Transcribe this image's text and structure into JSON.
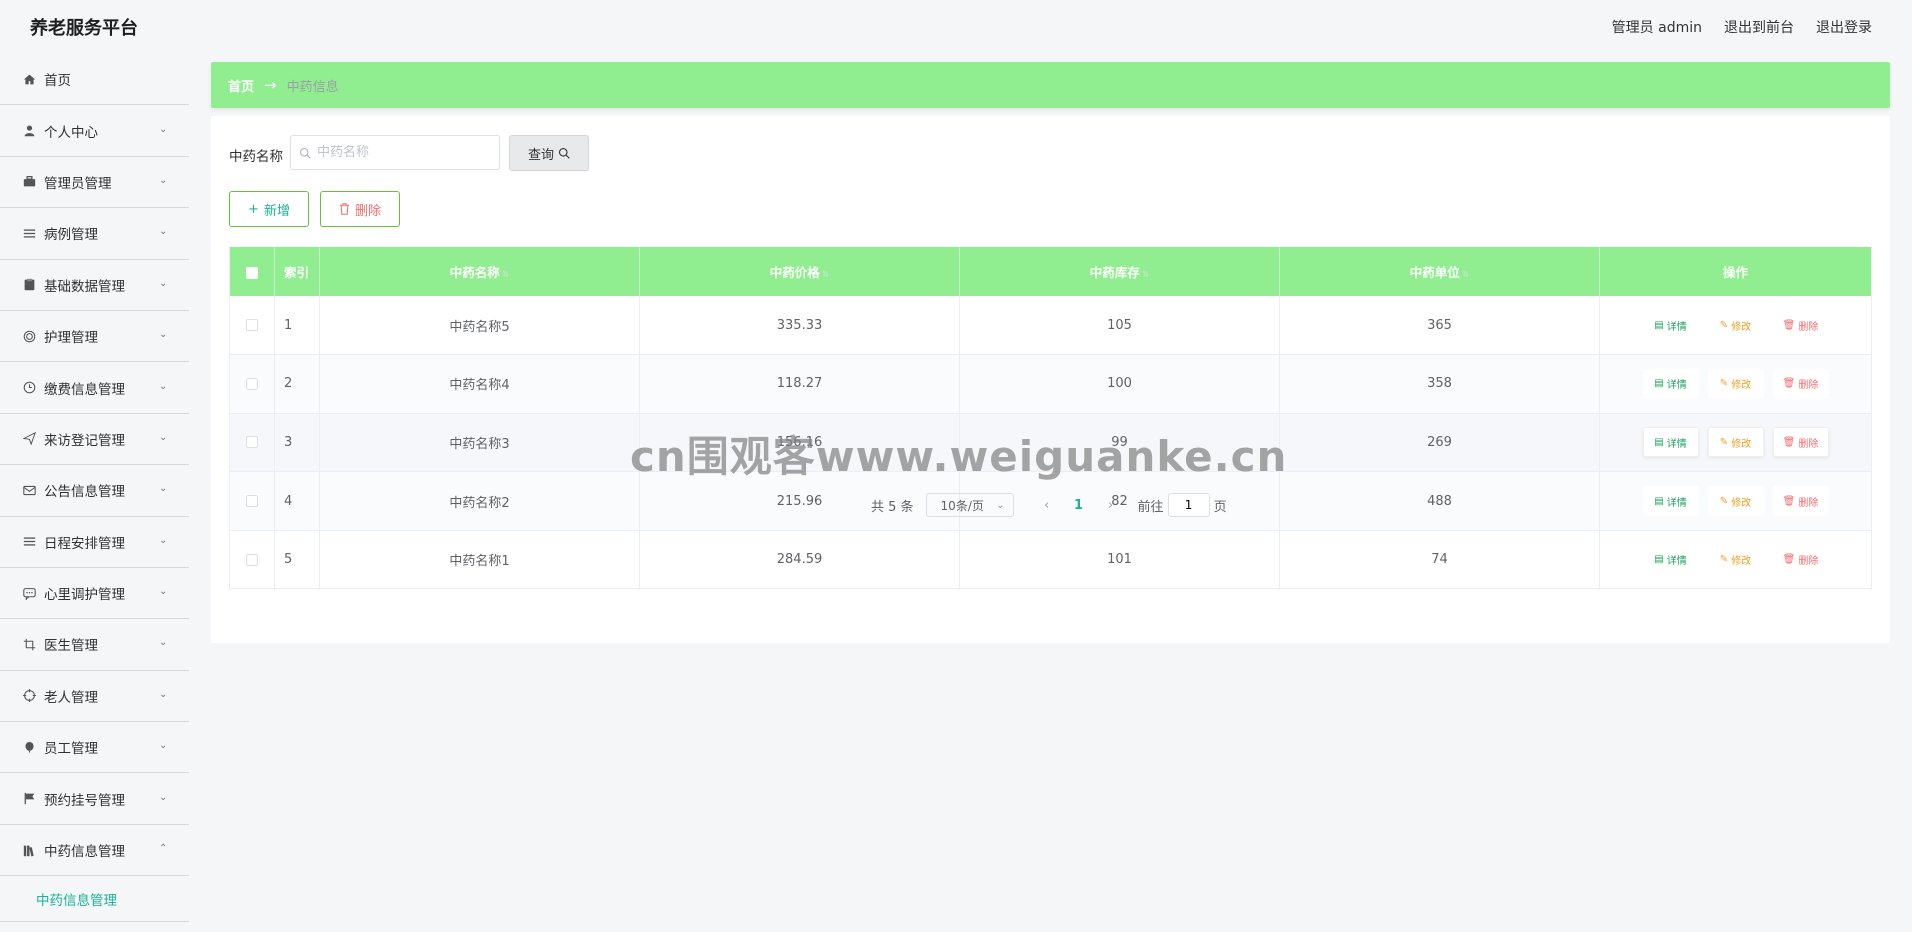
{
  "header": {
    "title": "养老服务平台",
    "admin_label": "管理员 admin",
    "back_front": "退出到前台",
    "logout": "退出登录"
  },
  "sidebar": {
    "items": [
      {
        "label": "首页",
        "icon": "home-icon"
      },
      {
        "label": "个人中心",
        "icon": "user-icon"
      },
      {
        "label": "管理员管理",
        "icon": "briefcase-icon"
      },
      {
        "label": "病例管理",
        "icon": "list-icon"
      },
      {
        "label": "基础数据管理",
        "icon": "clipboard-icon"
      },
      {
        "label": "护理管理",
        "icon": "target-icon"
      },
      {
        "label": "缴费信息管理",
        "icon": "clock-icon"
      },
      {
        "label": "来访登记管理",
        "icon": "send-icon"
      },
      {
        "label": "公告信息管理",
        "icon": "mail-icon"
      },
      {
        "label": "日程安排管理",
        "icon": "list-icon"
      },
      {
        "label": "心里调护管理",
        "icon": "chat-icon"
      },
      {
        "label": "医生管理",
        "icon": "crop-icon"
      },
      {
        "label": "老人管理",
        "icon": "aim-icon"
      },
      {
        "label": "员工管理",
        "icon": "balloon-icon"
      },
      {
        "label": "预约挂号管理",
        "icon": "flag-icon"
      },
      {
        "label": "中药信息管理",
        "icon": "books-icon"
      }
    ],
    "submenu_active": "中药信息管理"
  },
  "breadcrumb": {
    "home": "首页",
    "separator": "→",
    "current": "中药信息"
  },
  "search": {
    "label": "中药名称",
    "placeholder": "中药名称",
    "button": "查询"
  },
  "actions": {
    "add": "新增",
    "delete": "删除"
  },
  "table": {
    "headers": {
      "index": "索引",
      "name": "中药名称",
      "price": "中药价格",
      "stock": "中药库存",
      "unit": "中药单位",
      "ops": "操作"
    },
    "rows": [
      {
        "index": "1",
        "name": "中药名称5",
        "price": "335.33",
        "stock": "105",
        "unit": "365"
      },
      {
        "index": "2",
        "name": "中药名称4",
        "price": "118.27",
        "stock": "100",
        "unit": "358"
      },
      {
        "index": "3",
        "name": "中药名称3",
        "price": "156.16",
        "stock": "99",
        "unit": "269"
      },
      {
        "index": "4",
        "name": "中药名称2",
        "price": "215.96",
        "stock": "82",
        "unit": "488"
      },
      {
        "index": "5",
        "name": "中药名称1",
        "price": "284.59",
        "stock": "101",
        "unit": "74"
      }
    ],
    "op_labels": {
      "view": "详情",
      "edit": "修改",
      "delete": "删除"
    }
  },
  "pagination": {
    "total": "共 5 条",
    "page_size": "10条/页",
    "current_page": "1",
    "goto_prefix": "前往",
    "goto_value": "1",
    "goto_suffix": "页"
  },
  "watermark": "cn围观客www.weiguanke.cn",
  "colors": {
    "accent": "#90ee90",
    "active_text": "#1bb394",
    "danger": "#f56c6c",
    "warning": "#f0a020"
  }
}
